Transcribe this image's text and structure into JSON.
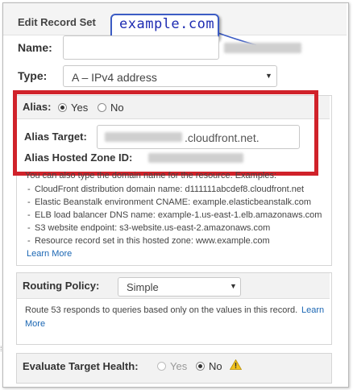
{
  "panel": {
    "title": "Edit Record Set"
  },
  "callout": {
    "text": "example.com"
  },
  "name_field": {
    "label": "Name:",
    "value": ""
  },
  "type_field": {
    "label": "Type:",
    "value": "A – IPv4 address"
  },
  "alias": {
    "label": "Alias:",
    "options": [
      {
        "label": "Yes",
        "selected": true
      },
      {
        "label": "No",
        "selected": false
      }
    ],
    "target_label": "Alias Target:",
    "target_suffix": ".cloudfront.net.",
    "zone_label": "Alias Hosted Zone ID:",
    "help_intro": "You can also type the domain name for the resource. Examples:",
    "examples": [
      "CloudFront distribution domain name: d111111abcdef8.cloudfront.net",
      "Elastic Beanstalk environment CNAME: example.elasticbeanstalk.com",
      "ELB load balancer DNS name: example-1.us-east-1.elb.amazonaws.com",
      "S3 website endpoint: s3-website.us-east-2.amazonaws.com",
      "Resource record set in this hosted zone: www.example.com"
    ],
    "learn_more": "Learn More"
  },
  "routing": {
    "label": "Routing Policy:",
    "value": "Simple",
    "description_line1": "Route 53 responds to queries based only on the values in this record.",
    "description_learn": "Learn",
    "description_more": "More"
  },
  "evaluate": {
    "label": "Evaluate Target Health:",
    "options": [
      {
        "label": "Yes",
        "selected": false
      },
      {
        "label": "No",
        "selected": true
      }
    ]
  },
  "colors": {
    "highlight": "#d0222a",
    "callout_border": "#3c5cc4",
    "link": "#1a66b3"
  },
  "icons": {
    "warning": "warning-icon",
    "dropdown": "chevron-down-icon"
  }
}
